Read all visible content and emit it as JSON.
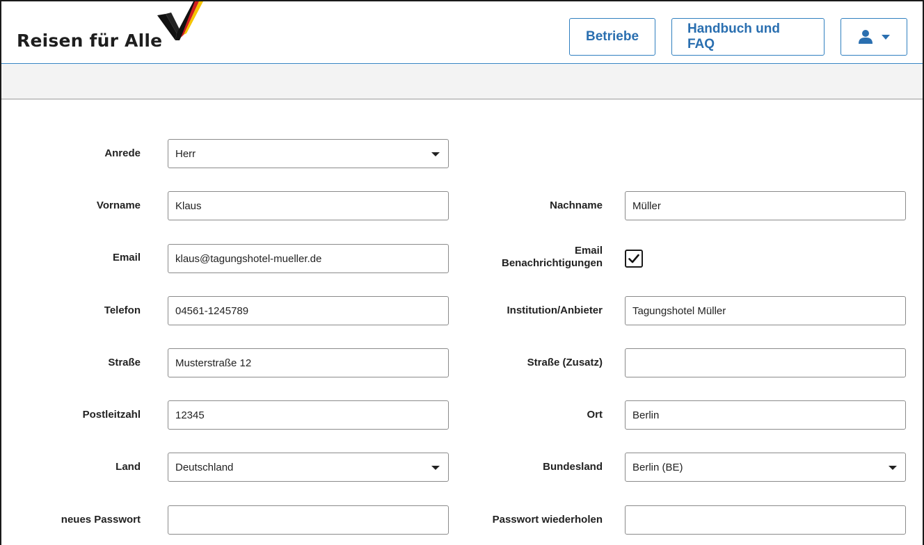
{
  "header": {
    "brand": "Reisen für Alle",
    "nav": {
      "betriebe": "Betriebe",
      "handbuch": "Handbuch und FAQ"
    }
  },
  "form": {
    "anrede": {
      "label": "Anrede",
      "value": "Herr"
    },
    "vorname": {
      "label": "Vorname",
      "value": "Klaus"
    },
    "nachname": {
      "label": "Nachname",
      "value": "Müller"
    },
    "email": {
      "label": "Email",
      "value": "klaus@tagungshotel-mueller.de"
    },
    "email_notifications": {
      "label_line1": "Email",
      "label_line2": "Benachrichtigungen",
      "checked": true
    },
    "telefon": {
      "label": "Telefon",
      "value": "04561-1245789"
    },
    "institution": {
      "label": "Institution/Anbieter",
      "value": "Tagungshotel Müller"
    },
    "strasse": {
      "label": "Straße",
      "value": "Musterstraße 12"
    },
    "strasse_zusatz": {
      "label": "Straße (Zusatz)",
      "value": ""
    },
    "postleitzahl": {
      "label": "Postleitzahl",
      "value": "12345"
    },
    "ort": {
      "label": "Ort",
      "value": "Berlin"
    },
    "land": {
      "label": "Land",
      "value": "Deutschland"
    },
    "bundesland": {
      "label": "Bundesland",
      "value": "Berlin (BE)"
    },
    "neues_passwort": {
      "label": "neues Passwort",
      "value": ""
    },
    "passwort_wiederholen": {
      "label": "Passwort wiederholen",
      "value": ""
    }
  },
  "colors": {
    "accent": "#2a6fb0",
    "subbar": "#f3f3f3"
  }
}
